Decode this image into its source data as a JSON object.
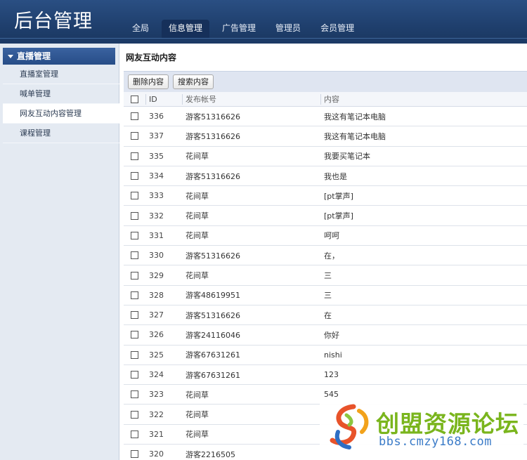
{
  "header": {
    "title": "后台管理",
    "nav": [
      {
        "label": "全局",
        "active": false
      },
      {
        "label": "信息管理",
        "active": true
      },
      {
        "label": "广告管理",
        "active": false
      },
      {
        "label": "管理员",
        "active": false
      },
      {
        "label": "会员管理",
        "active": false
      }
    ]
  },
  "sidebar": {
    "section_title": "直播管理",
    "items": [
      {
        "label": "直播室管理",
        "active": false
      },
      {
        "label": "喊单管理",
        "active": false
      },
      {
        "label": "网友互动内容管理",
        "active": true
      },
      {
        "label": "课程管理",
        "active": false
      }
    ]
  },
  "main": {
    "title": "网友互动内容",
    "toolbar": {
      "delete_label": "删除内容",
      "search_label": "搜索内容"
    },
    "columns": [
      "ID",
      "发布帐号",
      "内容"
    ],
    "rows": [
      {
        "id": "336",
        "account": "游客51316626",
        "content": "我这有笔记本电脑"
      },
      {
        "id": "337",
        "account": "游客51316626",
        "content": "我这有笔记本电脑"
      },
      {
        "id": "335",
        "account": "花间草",
        "content": "我要买笔记本"
      },
      {
        "id": "334",
        "account": "游客51316626",
        "content": "我也是"
      },
      {
        "id": "333",
        "account": "花间草",
        "content": "[pt掌声]"
      },
      {
        "id": "332",
        "account": "花间草",
        "content": "[pt掌声]"
      },
      {
        "id": "331",
        "account": "花间草",
        "content": "呵呵"
      },
      {
        "id": "330",
        "account": "游客51316626",
        "content": "在，"
      },
      {
        "id": "329",
        "account": "花间草",
        "content": "三"
      },
      {
        "id": "328",
        "account": "游客48619951",
        "content": "三"
      },
      {
        "id": "327",
        "account": "游客51316626",
        "content": "在"
      },
      {
        "id": "326",
        "account": "游客24116046",
        "content": "你好"
      },
      {
        "id": "325",
        "account": "游客67631261",
        "content": "nishi"
      },
      {
        "id": "324",
        "account": "游客67631261",
        "content": "123"
      },
      {
        "id": "323",
        "account": "花间草",
        "content": "545"
      },
      {
        "id": "322",
        "account": "花间草",
        "content": ""
      },
      {
        "id": "321",
        "account": "花间草",
        "content": ""
      },
      {
        "id": "320",
        "account": "游客2216505",
        "content": ""
      }
    ]
  },
  "watermark": {
    "name": "创盟资源论坛",
    "url": "bbs.cmzy168.com"
  },
  "colors": {
    "header_bg": "#1f3f6d",
    "sidebar_bg": "#e4eaf2",
    "toolbar_bg": "#dfe5f1",
    "watermark_green": "#7ab51d",
    "watermark_blue": "#3a7bc8"
  }
}
